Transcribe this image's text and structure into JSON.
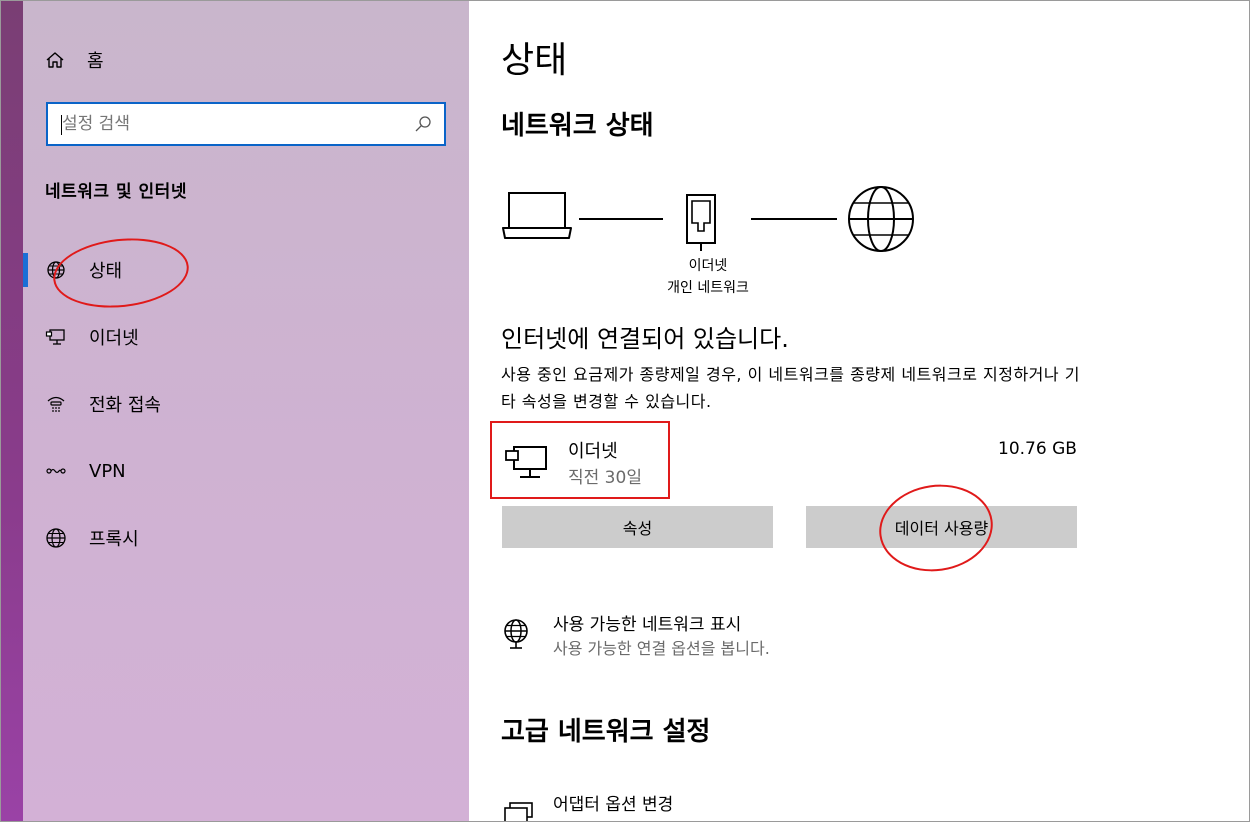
{
  "sidebar": {
    "home_label": "홈",
    "search_placeholder": "설정 검색",
    "section_title": "네트워크 및 인터넷",
    "items": [
      {
        "label": "상태",
        "icon": "globe-status-icon",
        "active": true
      },
      {
        "label": "이더넷",
        "icon": "ethernet-icon"
      },
      {
        "label": "전화 접속",
        "icon": "dialup-icon"
      },
      {
        "label": "VPN",
        "icon": "vpn-icon"
      },
      {
        "label": "프록시",
        "icon": "globe-icon"
      }
    ]
  },
  "main": {
    "title": "상태",
    "network_status_title": "네트워크 상태",
    "diagram": {
      "adapter_label": "이더넷",
      "network_label": "개인 네트워크"
    },
    "connected_title": "인터넷에 연결되어 있습니다.",
    "connected_desc": "사용 중인 요금제가 종량제일 경우, 이 네트워크를 종량제 네트워크로 지정하거나 기타 속성을 변경할 수 있습니다.",
    "connection": {
      "name": "이더넷",
      "period": "직전 30일",
      "usage": "10.76 GB"
    },
    "buttons": {
      "properties": "속성",
      "data_usage": "데이터 사용량"
    },
    "show_networks": {
      "title": "사용 가능한 네트워크 표시",
      "subtitle": "사용 가능한 연결 옵션을 봅니다."
    },
    "advanced_title": "고급 네트워크 설정",
    "adapter_options": {
      "title": "어댑터 옵션 변경"
    }
  },
  "colors": {
    "accent": "#1a6fd6",
    "annotation_red": "#e01a1a",
    "button_gray": "#cccccc"
  }
}
